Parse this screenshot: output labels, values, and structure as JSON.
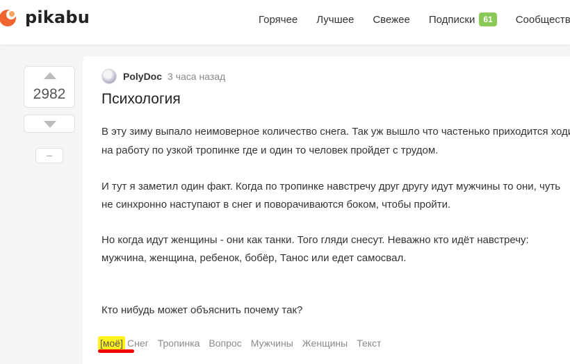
{
  "header": {
    "logo_text": "pikabu",
    "nav": [
      {
        "label": "Горячее"
      },
      {
        "label": "Лучшее"
      },
      {
        "label": "Свежее"
      },
      {
        "label": "Подписки",
        "badge": "61"
      },
      {
        "label": "Сообщества"
      }
    ]
  },
  "vote": {
    "count": "2982",
    "collapse_label": "–"
  },
  "story": {
    "author": "PolyDoc",
    "time": "3 часа назад",
    "title": "Психология",
    "lines": [
      "В эту зиму выпало неимоверное количество снега. Так уж вышло что частенько приходится ходить",
      "на работу по узкой тропинке где и один то человек пройдет с трудом.",
      "И тут я заметил один факт. Когда по тропинке навстречу друг другу идут мужчины то они, чуть",
      "не синхронно наступают в снег и поворачиваются боком, чтобы пройти.",
      "Но когда идут женщины - они как танки. Того гляди снесут. Неважно кто идёт навстречу:",
      "мужчина, женщина, ребенок, бобёр, Танос или едет самосвал.",
      "Кто нибудь может объяснить почему так?"
    ],
    "tags": [
      "[моё]",
      "Снег",
      "Тропинка",
      "Вопрос",
      "Мужчины",
      "Женщины",
      "Текст"
    ]
  },
  "colors": {
    "badge": "#8ac858",
    "tag_highlight": "#fff21a",
    "annotation_underline": "#e00000"
  }
}
